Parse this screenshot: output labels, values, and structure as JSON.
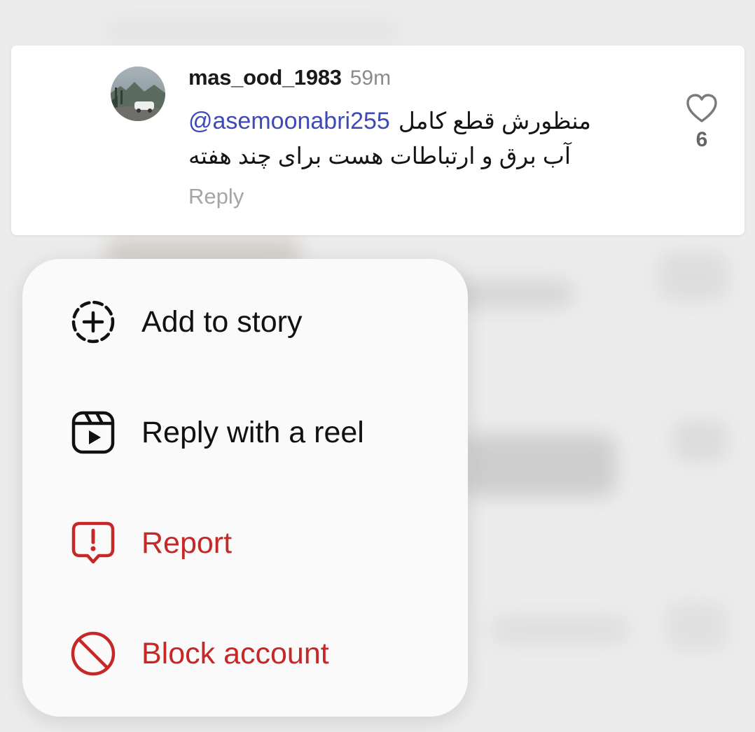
{
  "comment": {
    "username": "mas_ood_1983",
    "timestamp": "59m",
    "mention": "@asemoonabri255",
    "text_line1": "منظورش قطع کامل",
    "text_line2": "آب برق و ارتباطات هست برای چند هفته",
    "reply_label": "Reply",
    "like_count": "6"
  },
  "menu": {
    "items": [
      {
        "label": "Add to story",
        "icon": "add-to-story-icon",
        "danger": false
      },
      {
        "label": "Reply with a reel",
        "icon": "reel-icon",
        "danger": false
      },
      {
        "label": "Report",
        "icon": "report-icon",
        "danger": true
      },
      {
        "label": "Block account",
        "icon": "block-icon",
        "danger": true
      }
    ]
  },
  "colors": {
    "mention": "#3d4ab8",
    "danger": "#c62828",
    "muted": "#a5a5a5"
  }
}
